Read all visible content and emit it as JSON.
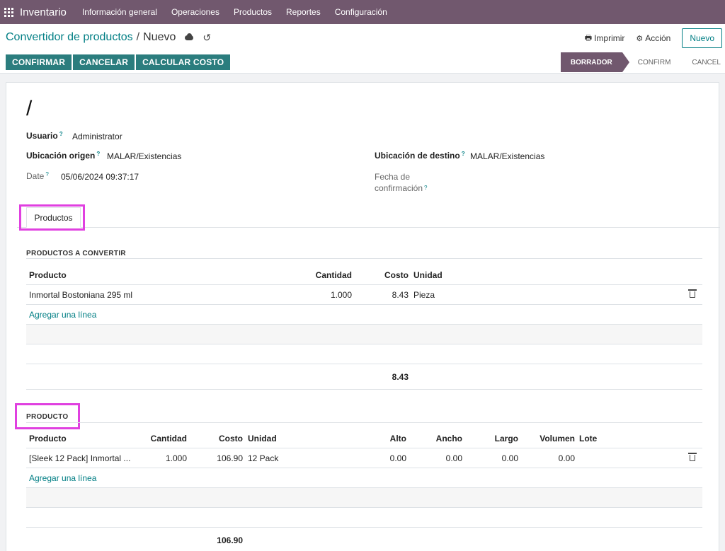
{
  "navbar": {
    "brand": "Inventario",
    "menu": [
      "Información general",
      "Operaciones",
      "Productos",
      "Reportes",
      "Configuración"
    ]
  },
  "breadcrumb": {
    "parent": "Convertidor de productos",
    "separator": "/",
    "current": "Nuevo"
  },
  "toolbar": {
    "print_label": "Imprimir",
    "action_label": "Acción",
    "new_label": "Nuevo"
  },
  "actions": {
    "confirm": "CONFIRMAR",
    "cancel": "CANCELAR",
    "compute_cost": "CALCULAR COSTO"
  },
  "statusbar": {
    "draft": "BORRADOR",
    "confirm": "CONFIRM",
    "cancel": "CANCEL"
  },
  "form": {
    "name": "/",
    "user_label": "Usuario",
    "user_value": "Administrator",
    "origin_label": "Ubicación origen",
    "origin_value": "MALAR/Existencias",
    "dest_label": "Ubicación de destino",
    "dest_value": "MALAR/Existencias",
    "date_label": "Date",
    "date_value": "05/06/2024 09:37:17",
    "confirm_date_label_1": "Fecha de",
    "confirm_date_label_2": "confirmación",
    "help_mark": "?"
  },
  "tabs": {
    "products": "Productos"
  },
  "convert_section": {
    "title": "PRODUCTOS A CONVERTIR",
    "headers": {
      "product": "Producto",
      "qty": "Cantidad",
      "cost": "Costo",
      "unit": "Unidad"
    },
    "rows": [
      {
        "product": "Inmortal Bostoniana 295 ml",
        "qty": "1.000",
        "cost": "8.43",
        "unit": "Pieza"
      }
    ],
    "add_line": "Agregar una línea",
    "total": "8.43"
  },
  "product_section": {
    "title": "PRODUCTO",
    "headers": {
      "product": "Producto",
      "qty": "Cantidad",
      "cost": "Costo",
      "unit": "Unidad",
      "height": "Alto",
      "width": "Ancho",
      "length": "Largo",
      "volume": "Volumen",
      "lot": "Lote"
    },
    "rows": [
      {
        "product": "[Sleek 12 Pack] Inmortal ...",
        "qty": "1.000",
        "cost": "106.90",
        "unit": "12 Pack",
        "height": "0.00",
        "width": "0.00",
        "length": "0.00",
        "volume": "0.00"
      }
    ],
    "add_line": "Agregar una línea",
    "total": "106.90"
  },
  "colors": {
    "navbar": "#71586e",
    "primary": "#2b7d7e",
    "link": "#017e84",
    "highlight": "#e040e0"
  }
}
